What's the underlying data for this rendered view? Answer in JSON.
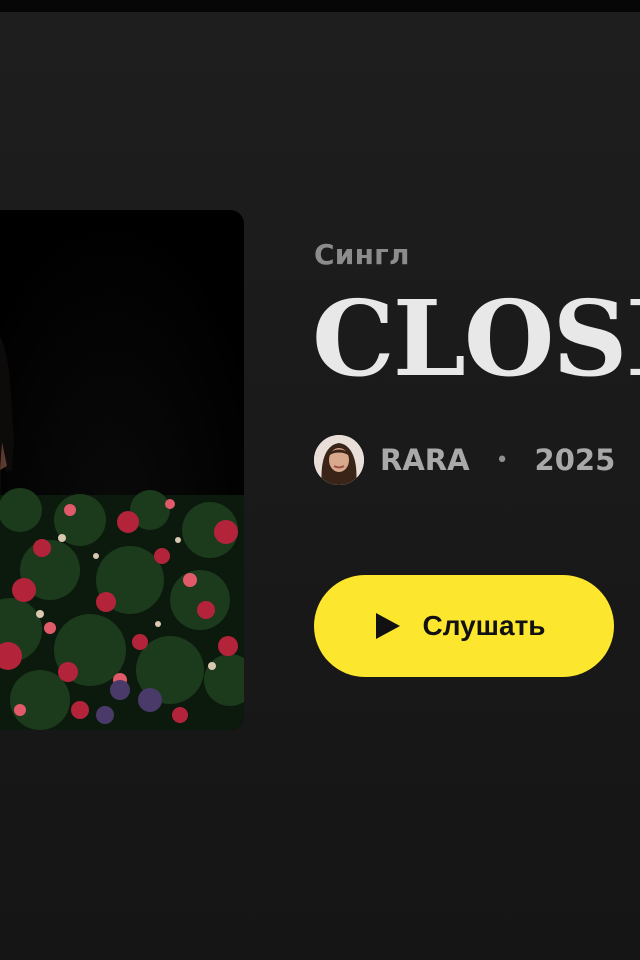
{
  "release": {
    "type_label": "Сингл",
    "title": "CLOSE",
    "artist": "RARA",
    "separator": "•",
    "year": "2025"
  },
  "actions": {
    "play_label": "Слушать"
  },
  "icons": {
    "play": "play-icon",
    "avatar": "artist-avatar"
  },
  "colors": {
    "background": "#1a1a1a",
    "accent": "#fde72e",
    "title": "#e8e8e8",
    "muted": "#8c8c8c"
  }
}
